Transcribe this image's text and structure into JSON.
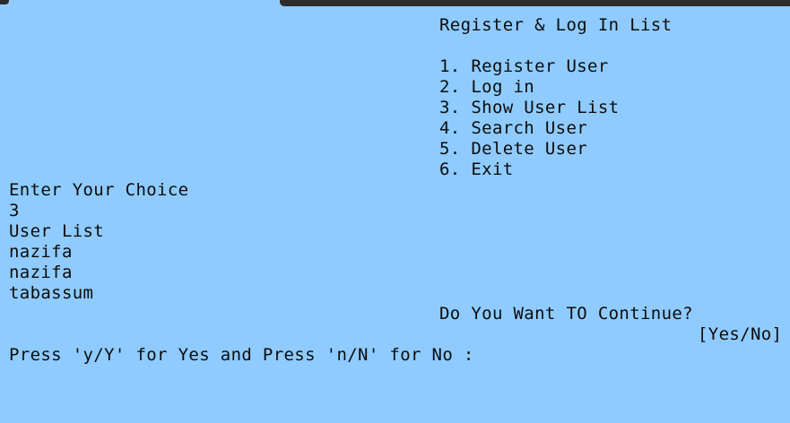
{
  "menu": {
    "title": "Register & Log In List",
    "items": [
      "1. Register User",
      "2. Log in",
      "3. Show User List",
      "4. Search User",
      "5. Delete User",
      "6. Exit"
    ]
  },
  "prompt": {
    "label": "Enter Your Choice",
    "input_value": "3"
  },
  "user_list": {
    "heading": "User List",
    "users": [
      "nazifa",
      "nazifa",
      "tabassum"
    ]
  },
  "continue_prompt": {
    "question": "Do You Want TO Continue?",
    "options": "[Yes/No]",
    "instruction": "Press 'y/Y' for Yes and Press 'n/N' for No :"
  }
}
